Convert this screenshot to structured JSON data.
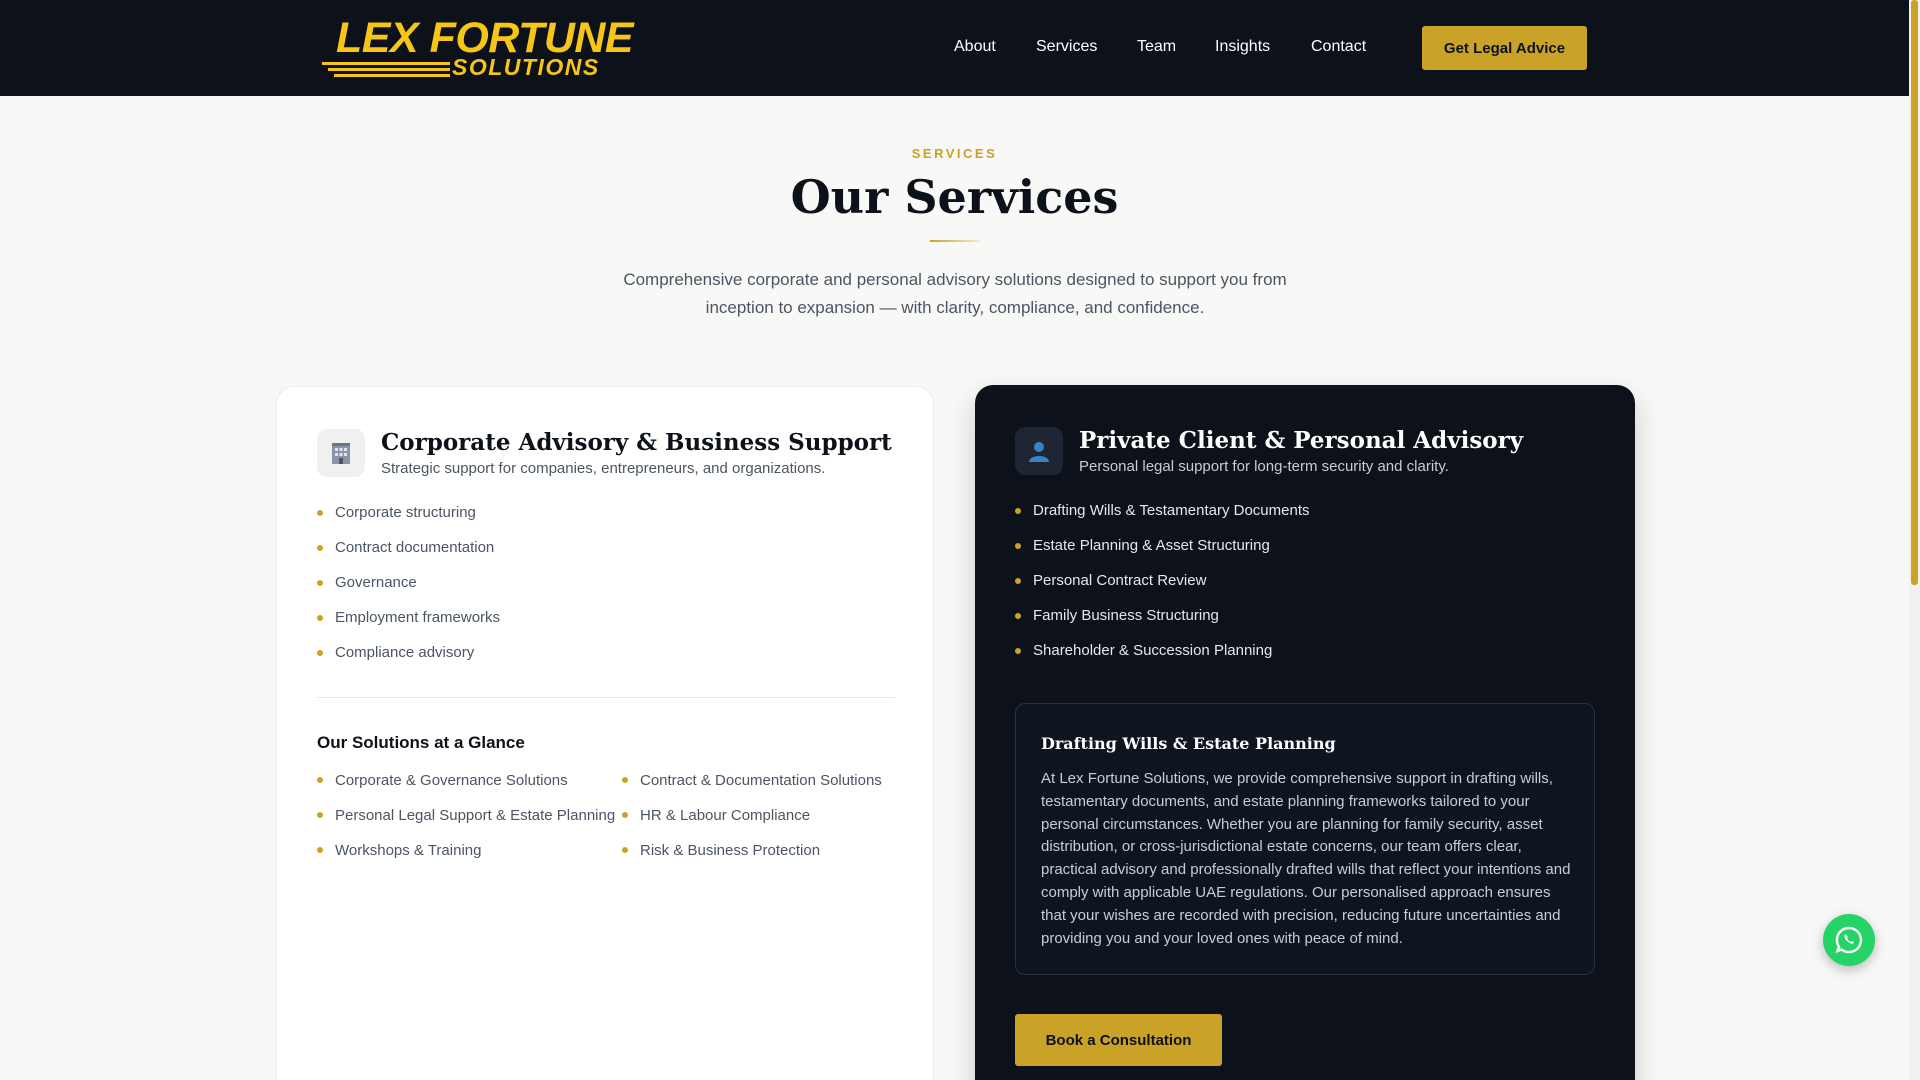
{
  "header": {
    "logo_top": "LEX FORTUNE",
    "logo_bottom": "SOLUTIONS",
    "nav": [
      "About",
      "Services",
      "Team",
      "Insights",
      "Contact"
    ],
    "cta": "Get Legal Advice"
  },
  "section": {
    "eyebrow": "SERVICES",
    "title": "Our Services",
    "intro": "Comprehensive corporate and personal advisory solutions designed to support you from inception to expansion — with clarity, compliance, and confidence."
  },
  "corporate": {
    "icon": "building-icon",
    "title": "Corporate Advisory & Business Support",
    "subtitle": "Strategic support for companies, entrepreneurs, and organizations.",
    "items": [
      "Corporate structuring",
      "Contract documentation",
      "Governance",
      "Employment frameworks",
      "Compliance advisory"
    ],
    "glance_title": "Our Solutions at a Glance",
    "glance": [
      "Corporate & Governance Solutions",
      "Contract & Documentation Solutions",
      "Personal Legal Support & Estate Planning",
      "HR & Labour Compliance",
      "Workshops & Training",
      "Risk & Business Protection"
    ]
  },
  "private": {
    "icon": "person-icon",
    "title": "Private Client & Personal Advisory",
    "subtitle": "Personal legal support for long-term security and clarity.",
    "items": [
      "Drafting Wills & Testamentary Documents",
      "Estate Planning & Asset Structuring",
      "Personal Contract Review",
      "Family Business Structuring",
      "Shareholder & Succession Planning"
    ],
    "detail_title": "Drafting Wills & Estate Planning",
    "detail_text": "At Lex Fortune Solutions, we provide comprehensive support in drafting wills, testamentary documents, and estate planning frameworks tailored to your personal circumstances. Whether you are planning for family security, asset distribution, or cross-jurisdictional estate concerns, our team offers clear, practical advisory and professionally drafted wills that reflect your intentions and comply with applicable UAE regulations. Our personalised approach ensures that your wishes are recorded with precision, reducing future uncertainties and providing you and your loved ones with peace of mind.",
    "cta": "Book a Consultation"
  },
  "floating": {
    "icon": "whatsapp-icon"
  },
  "colors": {
    "accent": "#c9a227",
    "dark": "#0c111a",
    "background": "#f8f8f6",
    "whatsapp": "#25d366"
  }
}
